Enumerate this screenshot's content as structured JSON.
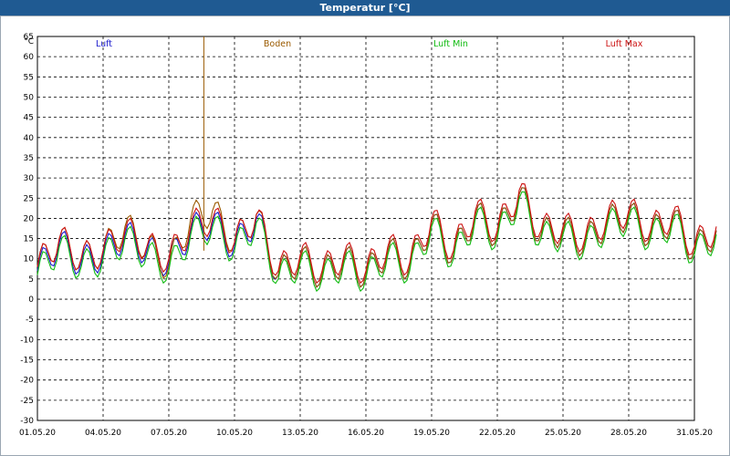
{
  "window": {
    "title": "Temperatur [°C]"
  },
  "chart_data": {
    "type": "line",
    "title": "Temperatur [°C]",
    "ylabel": "°C",
    "ylim": [
      -30,
      65
    ],
    "y_ticks": [
      "65",
      "60",
      "55",
      "50",
      "45",
      "40",
      "35",
      "30",
      "25",
      "20",
      "15",
      "10",
      "5",
      "0",
      "-5",
      "-10",
      "-15",
      "-20",
      "-25",
      "-30"
    ],
    "x_ticks": [
      "01.05.20",
      "04.05.20",
      "07.05.20",
      "10.05.20",
      "13.05.20",
      "16.05.20",
      "19.05.20",
      "22.05.20",
      "25.05.20",
      "28.05.20",
      "31.05.20"
    ],
    "grid": true,
    "legend_position": "top",
    "series": [
      {
        "name": "Luft",
        "color": "#1a1acc",
        "x": [
          "01.05.20",
          "02.05.20",
          "03.05.20",
          "04.05.20",
          "05.05.20",
          "06.05.20",
          "07.05.20",
          "08.05.20",
          "09.05.20",
          "10.05.20",
          "11.05.20",
          "12.05.20",
          "13.05.20",
          "14.05.20",
          "15.05.20",
          "16.05.20",
          "17.05.20",
          "18.05.20",
          "19.05.20",
          "20.05.20",
          "21.05.20",
          "22.05.20",
          "23.05.20",
          "24.05.20",
          "25.05.20",
          "26.05.20",
          "27.05.20",
          "28.05.20",
          "29.05.20",
          "30.05.20",
          "31.05.20",
          "01.06.20"
        ],
        "values": [
          7,
          14,
          9,
          11,
          16,
          12,
          9,
          17,
          19,
          13,
          20,
          6,
          10,
          6,
          10,
          6,
          12,
          8,
          19,
          11,
          21,
          16,
          26,
          16,
          17,
          14,
          19,
          21,
          16,
          20,
          12,
          17
        ]
      },
      {
        "name": "Boden",
        "color": "#9a5a00",
        "x": [
          "01.05.20",
          "02.05.20",
          "03.05.20",
          "04.05.20",
          "05.05.20",
          "06.05.20",
          "07.05.20",
          "08.05.20",
          "09.05.20",
          "10.05.20",
          "11.05.20",
          "12.05.20",
          "13.05.20",
          "14.05.20",
          "15.05.20",
          "16.05.20",
          "17.05.20",
          "18.05.20",
          "19.05.20",
          "20.05.20",
          "21.05.20",
          "22.05.20",
          "23.05.20",
          "24.05.20",
          "25.05.20",
          "26.05.20",
          "27.05.20",
          "28.05.20",
          "29.05.20",
          "30.05.20",
          "31.05.20",
          "01.06.20"
        ],
        "values": [
          8,
          15,
          10,
          12,
          18,
          13,
          8,
          20,
          22,
          14,
          21,
          6,
          10,
          6,
          10,
          6,
          12,
          8,
          19,
          11,
          21,
          16,
          26,
          16,
          17,
          14,
          19,
          21,
          16,
          20,
          12,
          17
        ]
      },
      {
        "name": "Luft Min",
        "color": "#11bb11",
        "x": [
          "01.05.20",
          "02.05.20",
          "03.05.20",
          "04.05.20",
          "05.05.20",
          "06.05.20",
          "07.05.20",
          "08.05.20",
          "09.05.20",
          "10.05.20",
          "11.05.20",
          "12.05.20",
          "13.05.20",
          "14.05.20",
          "15.05.20",
          "16.05.20",
          "17.05.20",
          "18.05.20",
          "19.05.20",
          "20.05.20",
          "21.05.20",
          "22.05.20",
          "23.05.20",
          "24.05.20",
          "25.05.20",
          "26.05.20",
          "27.05.20",
          "28.05.20",
          "29.05.20",
          "30.05.20",
          "31.05.20",
          "01.06.20"
        ],
        "values": [
          6,
          13,
          8,
          10,
          15,
          11,
          7,
          16,
          18,
          12,
          19,
          5,
          9,
          5,
          9,
          5,
          11,
          7,
          18,
          10,
          20,
          15,
          25,
          15,
          16,
          13,
          18,
          20,
          15,
          19,
          11,
          16
        ]
      },
      {
        "name": "Luft Max",
        "color": "#cc1111",
        "x": [
          "01.05.20",
          "02.05.20",
          "03.05.20",
          "04.05.20",
          "05.05.20",
          "06.05.20",
          "07.05.20",
          "08.05.20",
          "09.05.20",
          "10.05.20",
          "11.05.20",
          "12.05.20",
          "13.05.20",
          "14.05.20",
          "15.05.20",
          "16.05.20",
          "17.05.20",
          "18.05.20",
          "19.05.20",
          "20.05.20",
          "21.05.20",
          "22.05.20",
          "23.05.20",
          "24.05.20",
          "25.05.20",
          "26.05.20",
          "27.05.20",
          "28.05.20",
          "29.05.20",
          "30.05.20",
          "31.05.20",
          "01.06.20"
        ],
        "values": [
          8,
          15,
          10,
          12,
          17,
          13,
          10,
          18,
          20,
          14,
          21,
          7,
          11,
          7,
          11,
          7,
          13,
          9,
          20,
          12,
          22,
          17,
          27,
          17,
          18,
          15,
          20,
          22,
          17,
          21,
          13,
          18
        ]
      }
    ]
  }
}
